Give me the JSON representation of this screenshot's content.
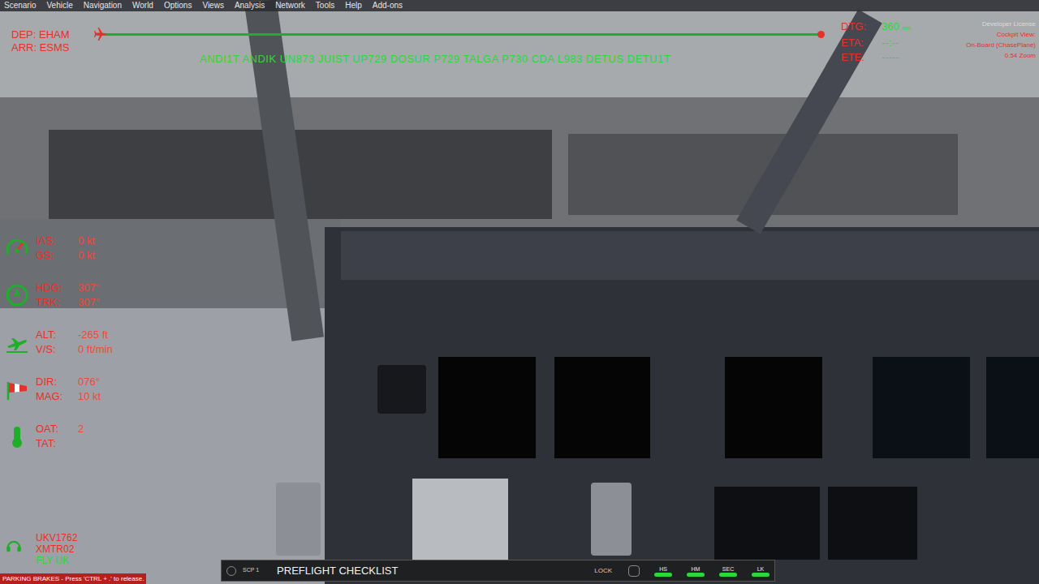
{
  "menu": [
    "Scenario",
    "Vehicle",
    "Navigation",
    "World",
    "Options",
    "Views",
    "Analysis",
    "Network",
    "Tools",
    "Help",
    "Add-ons"
  ],
  "route_bar": {
    "departure_label": "DEP:",
    "departure": "EHAM",
    "arrival_label": "ARR:",
    "arrival": "ESMS",
    "route": "ANDI1T ANDIK UN873 JUIST UP729 DOSUR P729 TALGA P730 CDA L983 DETUS DETU1T",
    "level": 0
  },
  "route_info": [
    {
      "label": "DTG:",
      "value": "360",
      "unit": "nm"
    },
    {
      "label": "ETA:",
      "value": "--:--",
      "unit": ""
    },
    {
      "label": "ETE:",
      "value": "-----",
      "unit": ""
    }
  ],
  "license": [
    "Developer License",
    "Cockpit View:",
    "On-Board (ChasePlane)",
    "0.54 Zoom"
  ],
  "hud": [
    {
      "kind": "speed",
      "rows": [
        {
          "label": "IAS:",
          "value": "0 kt"
        },
        {
          "label": "GS:",
          "value": "0 kt"
        }
      ]
    },
    {
      "kind": "heading",
      "rows": [
        {
          "label": "HDG:",
          "value": "307°"
        },
        {
          "label": "TRK:",
          "value": "307°"
        }
      ]
    },
    {
      "kind": "altitude",
      "rows": [
        {
          "label": "ALT:",
          "value": "-265 ft"
        },
        {
          "label": "V/S:",
          "value": "0 ft/min"
        }
      ]
    },
    {
      "kind": "wind",
      "rows": [
        {
          "label": "DIR:",
          "value": "076°"
        },
        {
          "label": "MAG:",
          "value": "10 kt"
        }
      ]
    },
    {
      "kind": "temperature",
      "rows": [
        {
          "label": "OAT:",
          "value": "2"
        },
        {
          "label": "TAT:",
          "value": ""
        }
      ]
    }
  ],
  "radio": {
    "callsign": "UKV1762",
    "transmitter": "XMTR02",
    "network": "FLY UK"
  },
  "notice": "PARKING BRAKES - Press 'CTRL + .' to release.",
  "checklist_bar": {
    "scp": "SCP 1",
    "title": "PREFLIGHT CHECKLIST",
    "lock": "LOCK",
    "buttons": [
      "HS",
      "HM",
      "SEC",
      "LK"
    ]
  }
}
